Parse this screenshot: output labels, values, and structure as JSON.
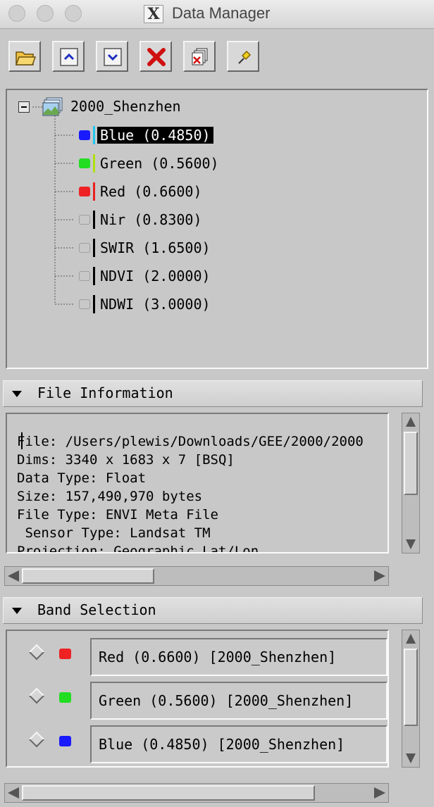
{
  "window": {
    "title": "Data Manager",
    "x_logo": "X"
  },
  "toolbar": {
    "buttons": [
      {
        "name": "open-file",
        "icon": "folder-icon"
      },
      {
        "name": "move-up",
        "icon": "chevron-up-icon"
      },
      {
        "name": "move-down",
        "icon": "chevron-down-icon"
      },
      {
        "name": "remove",
        "icon": "red-x-icon"
      },
      {
        "name": "close-all",
        "icon": "close-all-icon"
      },
      {
        "name": "pin",
        "icon": "pin-icon"
      }
    ]
  },
  "tree": {
    "root": "2000_Shenzhen",
    "bands": [
      {
        "label": "Blue (0.4850)",
        "swatch": "#1a1aff",
        "bar": "#22c6f0",
        "selected": true
      },
      {
        "label": "Green (0.5600)",
        "swatch": "#22dd22",
        "bar": "#b0e010",
        "selected": false
      },
      {
        "label": "Red (0.6600)",
        "swatch": "#ee2222",
        "bar": "#e82020",
        "selected": false
      },
      {
        "label": "Nir (0.8300)",
        "swatch": "",
        "bar": "#000000",
        "selected": false
      },
      {
        "label": "SWIR (1.6500)",
        "swatch": "",
        "bar": "#000000",
        "selected": false
      },
      {
        "label": "NDVI (2.0000)",
        "swatch": "",
        "bar": "#000000",
        "selected": false
      },
      {
        "label": "NDWI (3.0000)",
        "swatch": "",
        "bar": "#000000",
        "selected": false
      }
    ]
  },
  "file_info": {
    "header": "File Information",
    "lines": [
      "File: /Users/plewis/Downloads/GEE/2000/2000",
      "Dims: 3340 x 1683 x 7 [BSQ]",
      "Data Type: Float",
      "Size: 157,490,970 bytes",
      "File Type: ENVI Meta File",
      " Sensor Type: Landsat TM",
      "Projection: Geographic Lat/Lon"
    ]
  },
  "band_selection": {
    "header": "Band Selection",
    "rows": [
      {
        "label": "Red (0.6600) [2000_Shenzhen]",
        "swatch": "#ee2222"
      },
      {
        "label": "Green (0.5600) [2000_Shenzhen]",
        "swatch": "#22dd22"
      },
      {
        "label": "Blue (0.4850) [2000_Shenzhen]",
        "swatch": "#1a1aff"
      }
    ]
  }
}
